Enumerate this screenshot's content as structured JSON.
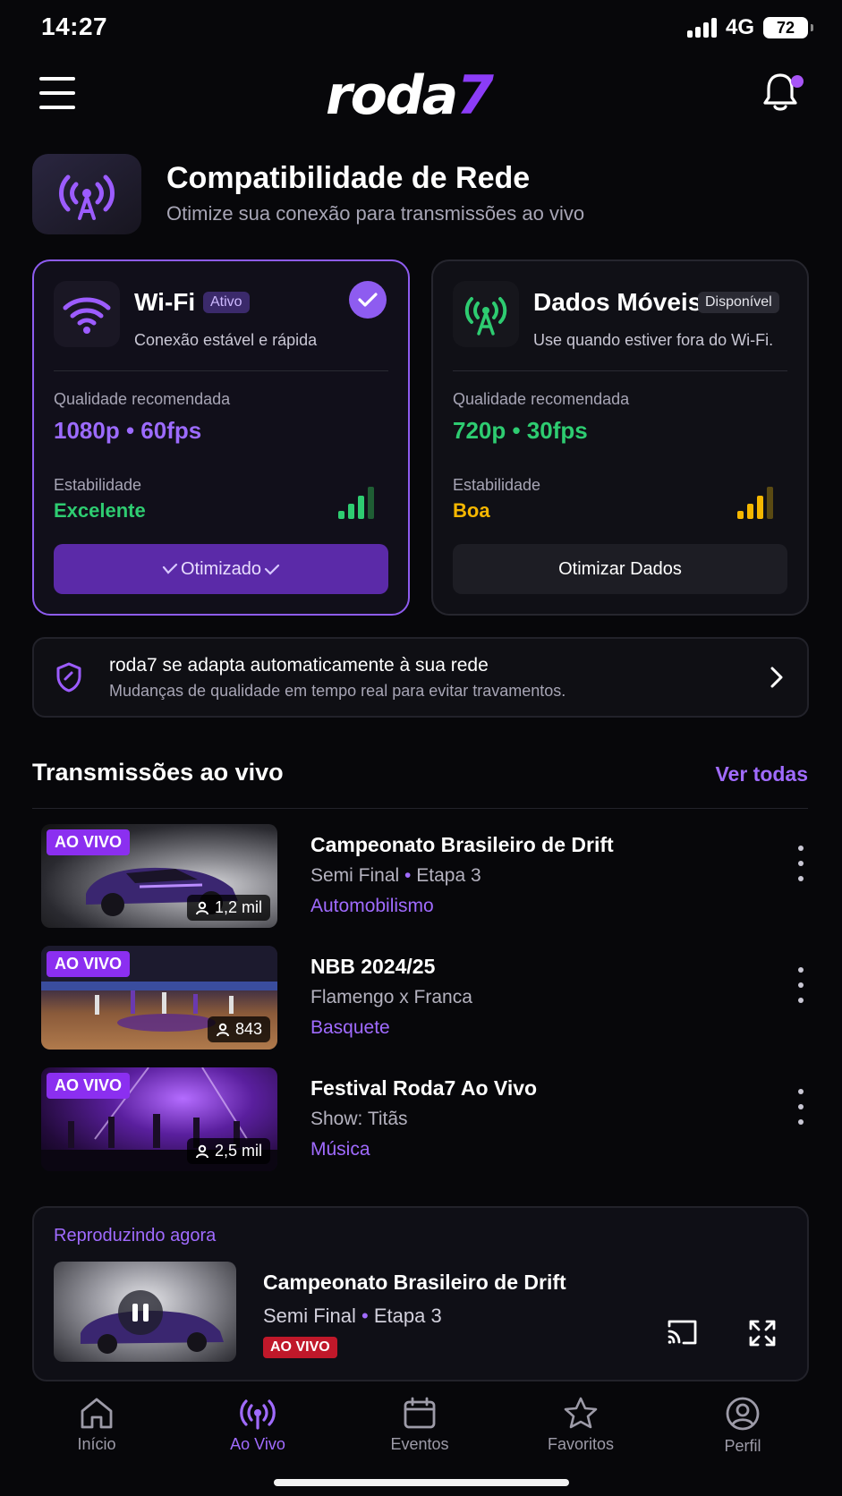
{
  "status": {
    "time": "14:27",
    "network": "4G",
    "battery": "72"
  },
  "header": {
    "logo_main": "roda",
    "logo_accent": "7"
  },
  "network_section": {
    "title": "Compatibilidade de Rede",
    "subtitle": "Otimize sua conexão para transmissões ao vivo",
    "cards": [
      {
        "name": "Wi-Fi",
        "badge": "Ativo",
        "description": "Conexão estável e rápida",
        "quality_label": "Qualidade recomendada",
        "quality_value": "1080p • 60fps",
        "stability_label": "Estabilidade",
        "stability_value": "Excelente",
        "button": "Otimizado",
        "quality_color": "#9c6bff",
        "stability_color": "#2ecc71",
        "active": true
      },
      {
        "name": "Dados Móveis",
        "badge": "Disponível",
        "description": "Use quando estiver fora do Wi-Fi.",
        "quality_label": "Qualidade recomendada",
        "quality_value": "720p • 30fps",
        "stability_label": "Estabilidade",
        "stability_value": "Boa",
        "button": "Otimizar Dados",
        "quality_color": "#2ecc71",
        "stability_color": "#f5b700",
        "active": false
      }
    ]
  },
  "adapt_banner": {
    "title": "roda7 se adapta automaticamente à sua rede",
    "subtitle": "Mudanças de qualidade em tempo real para evitar travamentos."
  },
  "live_section": {
    "title": "Transmissões ao vivo",
    "see_all": "Ver todas",
    "live_tag": "AO VIVO",
    "items": [
      {
        "title": "Campeonato Brasileiro de Drift",
        "sub_a": "Semi Final",
        "sub_sep": "•",
        "sub_b": "Etapa 3",
        "category": "Automobilismo",
        "viewers": "1,2 mil"
      },
      {
        "title": "NBB 2024/25",
        "sub_a": "Flamengo x Franca",
        "sub_sep": "",
        "sub_b": "",
        "category": "Basquete",
        "viewers": "843"
      },
      {
        "title": "Festival Roda7 Ao Vivo",
        "sub_a": "Show: Titãs",
        "sub_sep": "",
        "sub_b": "",
        "category": "Música",
        "viewers": "2,5 mil"
      }
    ]
  },
  "now_playing": {
    "label": "Reproduzindo agora",
    "title": "Campeonato Brasileiro de Drift",
    "sub_a": "Semi Final",
    "sub_sep": "•",
    "sub_b": "Etapa 3",
    "live_tag": "AO VIVO"
  },
  "tabs": [
    {
      "label": "Início",
      "icon": "home-icon"
    },
    {
      "label": "Ao Vivo",
      "icon": "live-broadcast-icon"
    },
    {
      "label": "Eventos",
      "icon": "calendar-icon"
    },
    {
      "label": "Favoritos",
      "icon": "star-icon"
    },
    {
      "label": "Perfil",
      "icon": "profile-icon"
    }
  ],
  "colors": {
    "accent": "#8b3cf7",
    "accent_text": "#a06bff",
    "live_red": "#c0182a",
    "background": "#07070a"
  }
}
